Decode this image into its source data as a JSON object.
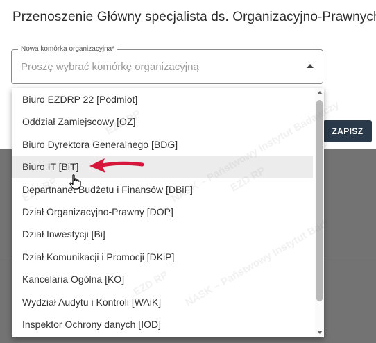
{
  "dialog": {
    "title": "Przenoszenie Główny specjalista ds. Organizacyjno-Prawnych",
    "save_label": "ZAPISZ"
  },
  "field": {
    "label": "Nowa komórka organizacyjna*",
    "placeholder": "Proszę wybrać komórkę organizacyjną"
  },
  "dropdown": {
    "items": [
      "Biuro EZDRP 22 [Podmiot]",
      "Oddział Zamiejscowy [OZ]",
      "Biuro Dyrektora Generalnego [BDG]",
      "Biuro IT [BiT]",
      "Departnanet Budżetu i Finansów [DBiF]",
      "Dział Organizacyjno-Prawny [DOP]",
      "Dział Inwestycji [Bi]",
      "Dział Komunikacji i Promocji [DKiP]",
      "Kancelaria Ogólna [KO]",
      "Wydział Audytu i Kontroli [WAiK]",
      "Inspektor Ochrony danych [IOD]"
    ],
    "hovered_index": 3
  },
  "watermarks": {
    "brand": "EZD RP",
    "org": "NASK – Państwowy Instytut Badawczy"
  },
  "colors": {
    "save_button_bg": "#2a3a4a",
    "annotation_arrow": "#d6173b"
  },
  "icons": {
    "caret": "caret-up-icon",
    "cursor": "hand-pointer-icon",
    "arrow": "red-arrow-icon"
  }
}
